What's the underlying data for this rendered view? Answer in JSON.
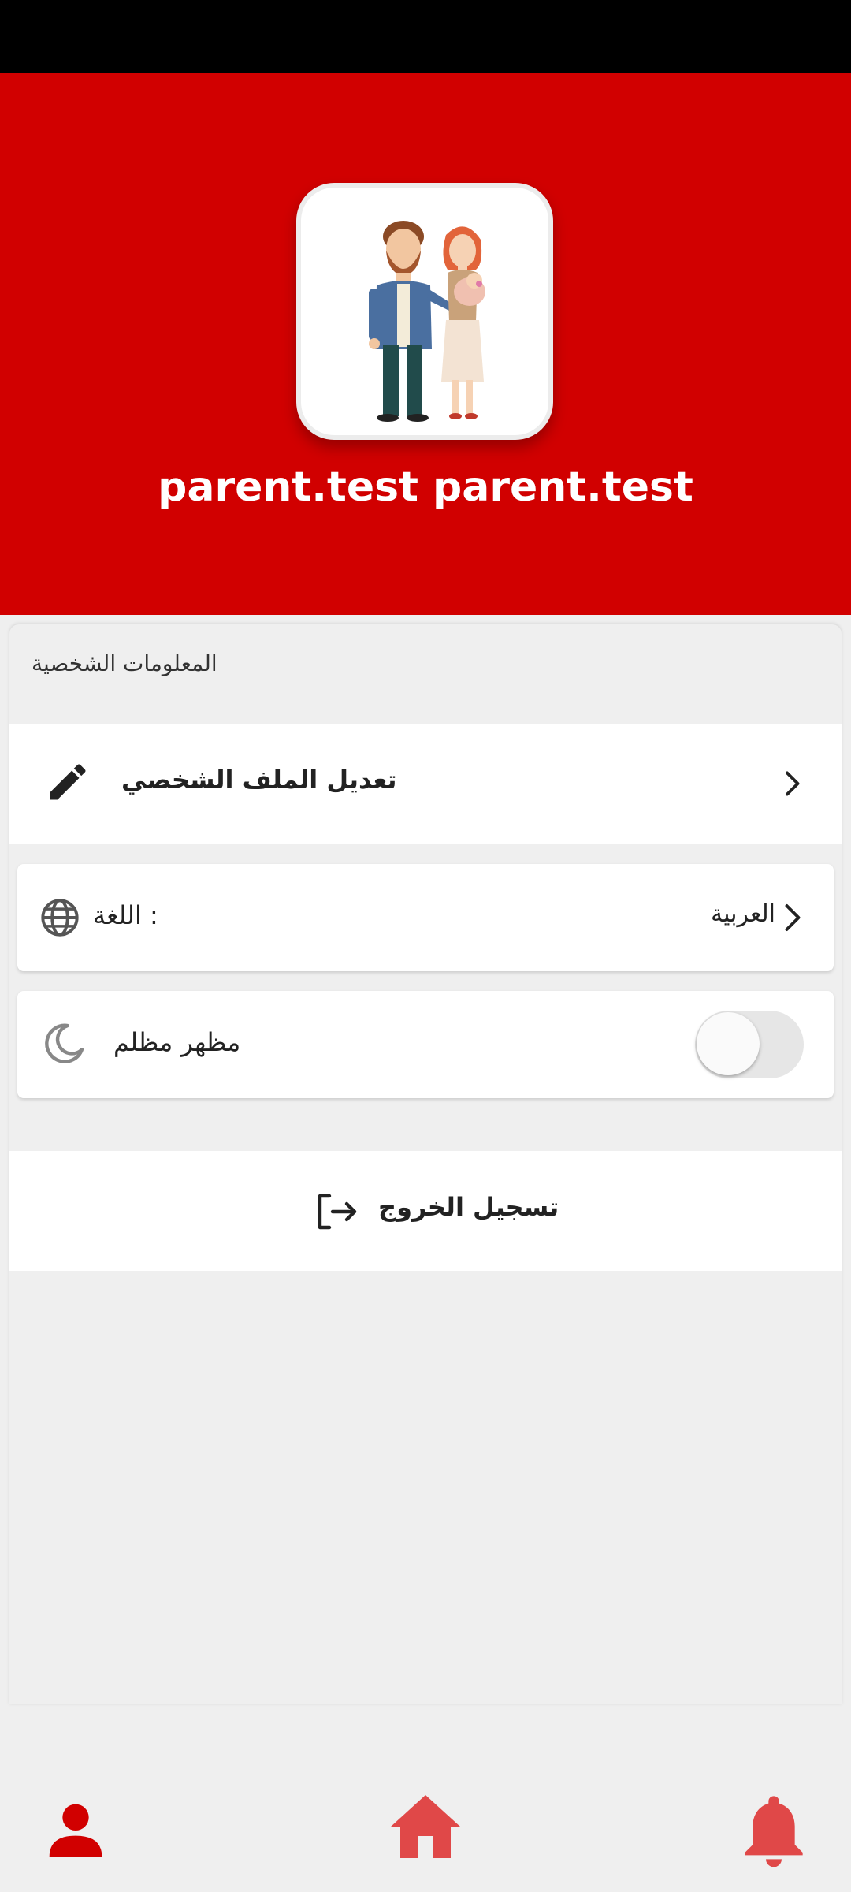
{
  "header": {
    "user_name": "parent.test parent.test",
    "avatar_icon": "parents-illustration-icon",
    "background_color": "#d10000"
  },
  "personal_info": {
    "section_title": "المعلومات الشخصية",
    "edit_profile_label": "تعديل الملف الشخصي"
  },
  "settings": {
    "language_label": ": اللغة",
    "language_value": "العربية",
    "dark_mode_label": "مظهر مظلم",
    "dark_mode_enabled": false
  },
  "logout": {
    "label": "تسجيل الخروج"
  },
  "bottom_nav": {
    "items": [
      {
        "icon": "person-icon",
        "active": true
      },
      {
        "icon": "home-icon",
        "active": false
      },
      {
        "icon": "bell-icon",
        "active": false
      }
    ],
    "accent_color": "#d10000"
  }
}
